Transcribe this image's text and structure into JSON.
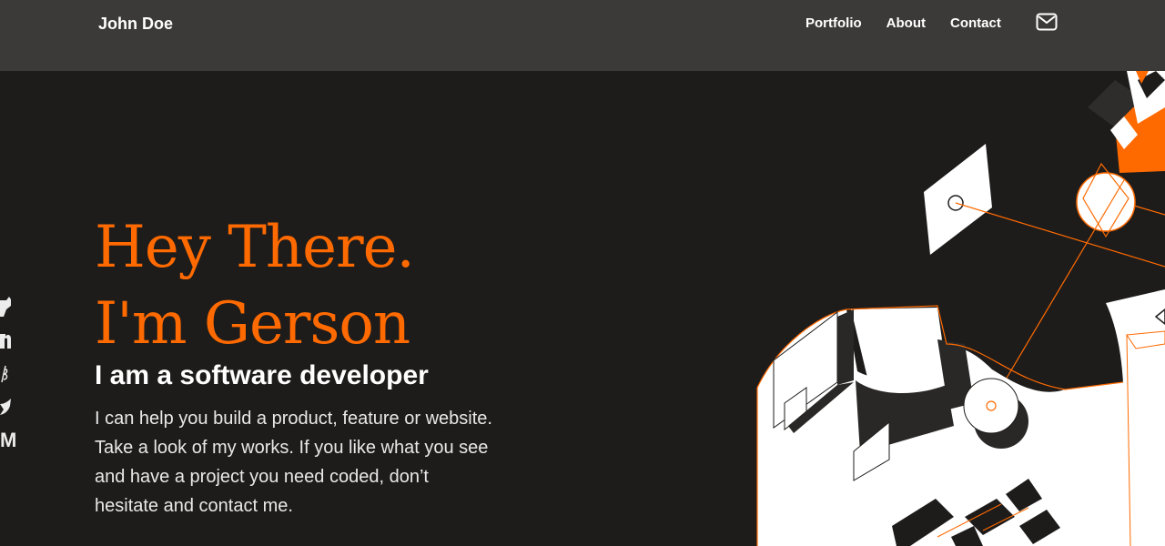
{
  "nav": {
    "brand": "John Doe",
    "links": [
      "Portfolio",
      "About",
      "Contact"
    ],
    "mail_icon": "mail-icon"
  },
  "hero": {
    "greeting_line1": "Hey There.",
    "greeting_line2": "I'm Gerson",
    "subtitle": "I am a software developer",
    "description": "I can help you build a product, feature or website. Take a look of my works. If you like what you see and have a project you need coded, don’t hesitate and contact me."
  },
  "social": {
    "icons": [
      "github-icon",
      "linkedin-icon",
      "codepen-icon",
      "twitter-icon",
      "medium-icon"
    ],
    "medium_glyph": "M"
  },
  "colors": {
    "accent": "#ff6a00",
    "background": "#1e1c1b",
    "navbar": "#3c3a39"
  }
}
